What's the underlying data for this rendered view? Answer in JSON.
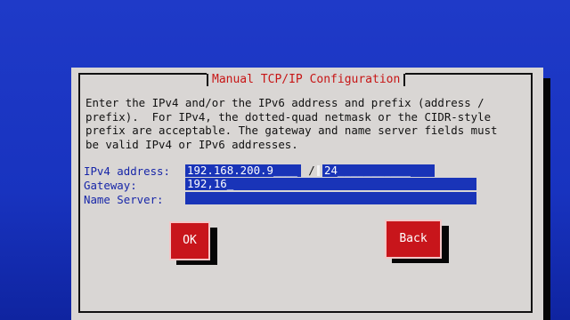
{
  "dialog": {
    "title": "Manual TCP/IP Configuration",
    "description_lines": [
      "Enter the IPv4 and/or the IPv6 address and prefix (address /",
      "prefix).  For IPv4, the dotted-quad netmask or the CIDR-style",
      "prefix are acceptable. The gateway and name server fields must",
      "be valid IPv4 or IPv6 addresses."
    ]
  },
  "form": {
    "ipv4_label": "IPv4 address:",
    "ipv4_address": "192.168.200.9",
    "separator": "/",
    "ipv4_prefix": "24",
    "gateway_label": "Gateway:",
    "gateway": "192,16",
    "nameserver_label": "Name Server:",
    "nameserver": ""
  },
  "buttons": {
    "ok_label": "OK",
    "back_label": "Back"
  },
  "colors": {
    "background": "#1a34c2",
    "dialog": "#d9d6d4",
    "title_text": "#c71515",
    "field_fill": "#1934b8",
    "button_fill": "#c8151b"
  }
}
